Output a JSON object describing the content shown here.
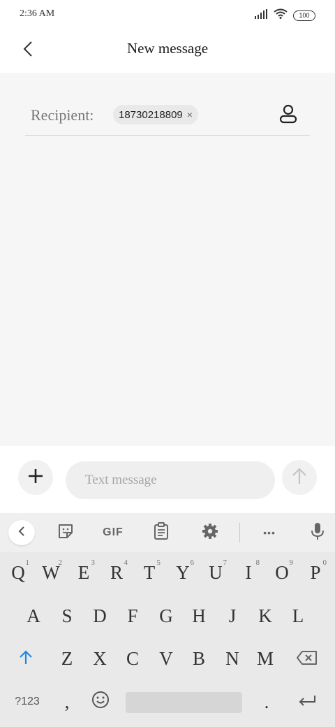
{
  "status_bar": {
    "time": "2:36 AM",
    "battery": "100"
  },
  "header": {
    "title": "New message"
  },
  "recipient": {
    "label": "Recipient:",
    "chip": "18730218809",
    "remove": "×"
  },
  "composer": {
    "placeholder": "Text message"
  },
  "keyboard": {
    "toolbar": {
      "gif": "GIF",
      "more": "•••"
    },
    "row1": [
      {
        "key": "Q",
        "hint": "1"
      },
      {
        "key": "W",
        "hint": "2"
      },
      {
        "key": "E",
        "hint": "3"
      },
      {
        "key": "R",
        "hint": "4"
      },
      {
        "key": "T",
        "hint": "5"
      },
      {
        "key": "Y",
        "hint": "6"
      },
      {
        "key": "U",
        "hint": "7"
      },
      {
        "key": "I",
        "hint": "8"
      },
      {
        "key": "O",
        "hint": "9"
      },
      {
        "key": "P",
        "hint": "0"
      }
    ],
    "row2": [
      "A",
      "S",
      "D",
      "F",
      "G",
      "H",
      "J",
      "K",
      "L"
    ],
    "row3": [
      "Z",
      "X",
      "C",
      "V",
      "B",
      "N",
      "M"
    ],
    "row4": {
      "symbols": "?123",
      "comma": ",",
      "period": "."
    }
  },
  "colors": {
    "shift_accent": "#1e88e5",
    "compose_bg": "#f6f6f6",
    "keyboard_bg": "#e9e9e9"
  },
  "icons": [
    "back-arrow-icon",
    "signal-icon",
    "wifi-icon",
    "battery-icon",
    "contact-icon",
    "plus-icon",
    "send-arrow-icon",
    "collapse-keyboard-icon",
    "sticker-icon",
    "clipboard-icon",
    "gear-icon",
    "more-icon",
    "mic-icon",
    "shift-icon",
    "backspace-icon",
    "emoji-icon",
    "enter-icon"
  ]
}
